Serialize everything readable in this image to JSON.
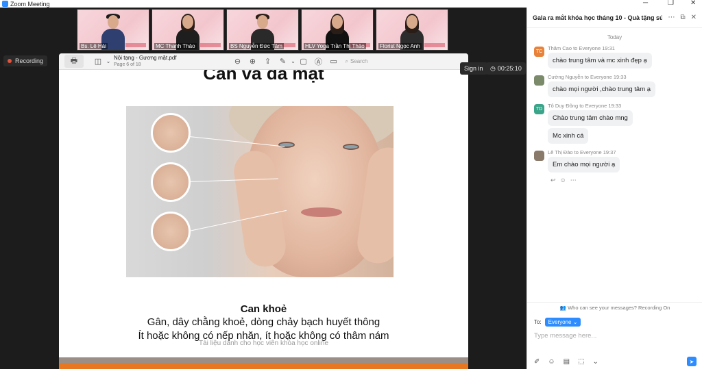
{
  "window": {
    "title": "Zoom Meeting"
  },
  "participants": [
    {
      "name": "Bs. Lê Hải"
    },
    {
      "name": "MC Thanh Thảo"
    },
    {
      "name": "BS Nguyễn Đức Tâm"
    },
    {
      "name": "HLV Yoga Trần Thị Thảo"
    },
    {
      "name": "Florist Ngọc Anh"
    }
  ],
  "recording_label": "Recording",
  "signin_label": "Sign in",
  "timer": "00:25:10",
  "pdf": {
    "filename": "Nội tạng - Gương mặt.pdf",
    "page": "Page 6 of 18",
    "search_placeholder": "Search"
  },
  "slide": {
    "title": "Can và da mặt",
    "caption_bold": "Can khoẻ",
    "caption_line2": "Gân, dây chằng khoẻ, dòng chảy bạch huyết thông",
    "caption_line3": "Ít hoặc không có nếp nhăn, ít hoặc không có thâm nám",
    "watermark": "Tài liệu dành cho học viên khóa học online"
  },
  "chat": {
    "title": "Gala ra mắt khóa học tháng 10 - Quà tặng sứ...",
    "today": "Today",
    "messages": [
      {
        "initials": "TC",
        "avatar_color": "#e8823a",
        "sender": "Thâm Cao to Everyone 19:31",
        "texts": [
          "chào trung tâm và mc xinh đẹp ạ"
        ]
      },
      {
        "initials": "",
        "avatar_color": "#7a8a6a",
        "sender": "Cường Nguyễn to Everyone 19:33",
        "texts": [
          "chào mọi người ,chào trung tâm ạ"
        ]
      },
      {
        "initials": "TD",
        "avatar_color": "#3aa58a",
        "sender": "Tô Duy Đông to Everyone 19:33",
        "texts": [
          "Chào trung tâm chào mng",
          "Mc xinh cá"
        ]
      },
      {
        "initials": "",
        "avatar_color": "#8a7a6a",
        "sender": "Lê Thị Đào to Everyone 19:37",
        "texts": [
          "Em chào mọi người ạ"
        ]
      }
    ],
    "info": "Who can see your messages? Recording On",
    "to_label": "To:",
    "to_value": "Everyone",
    "input_placeholder": "Type message here..."
  }
}
